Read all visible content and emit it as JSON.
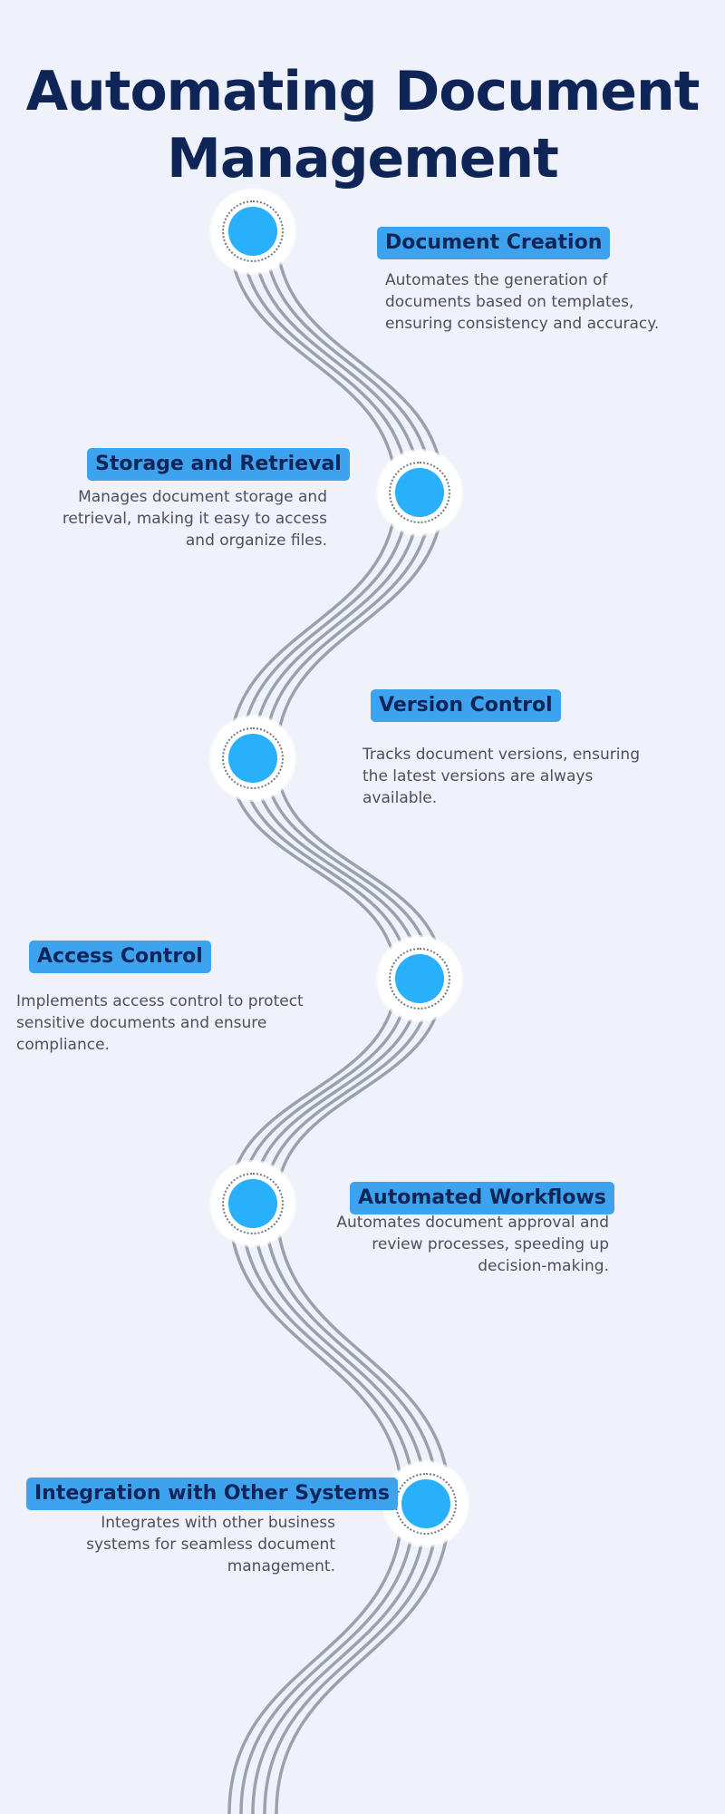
{
  "title": "Automating Document Management",
  "colors": {
    "background": "#eff2fb",
    "title": "#0f2557",
    "label_bg": "#3ea3ee",
    "node_fill": "#29b0fb",
    "path_stroke": "#9aa1ad",
    "desc_text": "#4d5058"
  },
  "steps": [
    {
      "label": "Document Creation",
      "description": "Automates the generation of documents based on templates, ensuring consistency and accuracy."
    },
    {
      "label": "Storage and Retrieval",
      "description": "Manages document storage and retrieval, making it easy to access and organize files."
    },
    {
      "label": "Version Control",
      "description": "Tracks document versions, ensuring the latest versions are always available."
    },
    {
      "label": "Access Control",
      "description": "Implements access control to protect sensitive documents and ensure compliance."
    },
    {
      "label": "Automated Workflows",
      "description": "Automates document approval and review processes, speeding up decision-making."
    },
    {
      "label": "Integration with Other Systems",
      "description": "Integrates with other business systems for seamless document management."
    }
  ]
}
